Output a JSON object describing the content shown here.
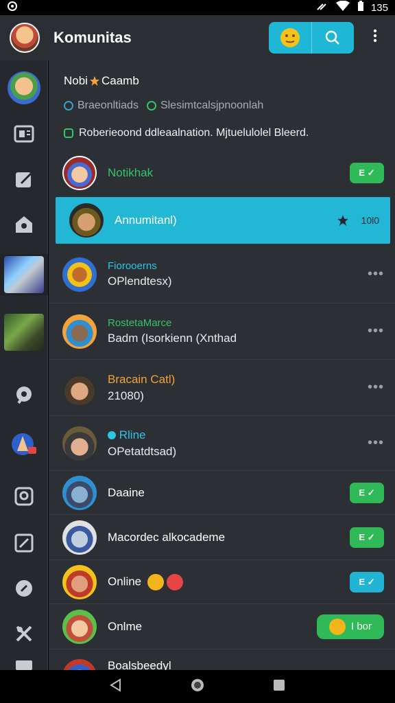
{
  "status_bar": {
    "left_icon": "app-notification-icon",
    "time": "135",
    "icons": [
      "signal-icon",
      "wifi-icon",
      "battery-icon"
    ]
  },
  "appbar": {
    "title": "Komunitas",
    "actions": [
      "emoji-icon",
      "search-icon"
    ],
    "menu": "more-vert-icon"
  },
  "sidebar": {
    "items": [
      "profile-avatar",
      "news-icon",
      "edit-icon",
      "badge-icon",
      "game-thumb-1",
      "game-thumb-2",
      "location-icon",
      "user-badge-avatar",
      "chat-icon",
      "checkbox-icon",
      "message-icon",
      "tools-icon",
      "list-icon"
    ]
  },
  "header": {
    "title": "Nobi",
    "title_suffix": "Caamb",
    "subtitle_a": "Braeonltiads",
    "subtitle_b": "Slesimtcalsjpnoonlah",
    "note": "Roberieoond ddleaalnation. Mjtuelulolel Bleerd."
  },
  "rows": [
    {
      "name": "Notikhak",
      "sub": "",
      "name_color": "#34c46a",
      "right": "pill",
      "right_label": "E ✓",
      "pill_color": "green"
    },
    {
      "name": "Annumitanl)",
      "sub": "",
      "name_color": "#ffffff",
      "right": "active",
      "right_label": "10l0",
      "active": true
    },
    {
      "name": "Fiorooerns",
      "sub": "OPlendtesx)",
      "name_color": "#2ec4e6",
      "right": "more",
      "right_label": "•••"
    },
    {
      "name": "RostetaMarce",
      "sub": "Badm (Isorkienn (Xnthad",
      "name_color": "#34c46a",
      "right": "more",
      "right_label": "•••"
    },
    {
      "name": "Bracain Catl)",
      "sub": "21080)",
      "name_color": "#f2a33a",
      "right": "more",
      "right_label": "•••"
    },
    {
      "name": "Rline",
      "sub": "OPetatdtsad)",
      "name_color": "#2ec4e6",
      "right": "more",
      "right_label": "•••"
    },
    {
      "name": "Daaine",
      "sub": "",
      "name_color": "#ffffff",
      "right": "pill",
      "right_label": "E ✓",
      "pill_color": "green"
    },
    {
      "name": "Macordec alkocademe",
      "sub": "",
      "name_color": "#ffffff",
      "right": "pill",
      "right_label": "E ✓",
      "pill_color": "green"
    },
    {
      "name": "Online",
      "sub": "",
      "name_color": "#ffffff",
      "right": "pill",
      "right_label": "E ✓",
      "pill_color": "blue",
      "emoji": true
    },
    {
      "name": "Onlme",
      "sub": "",
      "name_color": "#ffffff",
      "right": "pill-wide",
      "right_label": "I bor",
      "pill_color": "green"
    },
    {
      "name": "Boalsbeedyl",
      "sub": "",
      "name_color": "#ffffff",
      "right": "none",
      "right_label": ""
    }
  ],
  "navbar": {
    "back": "back-triangle-icon",
    "home": "home-circle-icon",
    "recents": "recents-square-icon"
  }
}
